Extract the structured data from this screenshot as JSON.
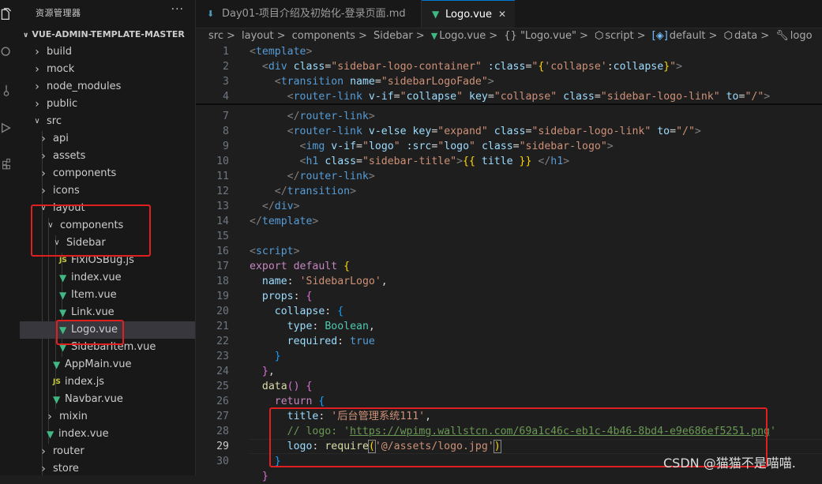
{
  "activity_bar": {
    "icons": [
      "files-icon",
      "search-icon",
      "source-control-icon",
      "run-debug-icon",
      "extensions-icon"
    ]
  },
  "explorer": {
    "title": "资源管理器",
    "more": "···",
    "project": "VUE-ADMIN-TEMPLATE-MASTER",
    "items": [
      {
        "label": "build",
        "type": "folder",
        "open": false
      },
      {
        "label": "mock",
        "type": "folder",
        "open": false
      },
      {
        "label": "node_modules",
        "type": "folder",
        "open": false
      },
      {
        "label": "public",
        "type": "folder",
        "open": false
      },
      {
        "label": "src",
        "type": "folder",
        "open": true
      },
      {
        "label": "api",
        "type": "folder",
        "open": false
      },
      {
        "label": "assets",
        "type": "folder",
        "open": false
      },
      {
        "label": "components",
        "type": "folder",
        "open": false
      },
      {
        "label": "icons",
        "type": "folder",
        "open": false
      },
      {
        "label": "layout",
        "type": "folder",
        "open": true
      },
      {
        "label": "components",
        "type": "folder",
        "open": true
      },
      {
        "label": "Sidebar",
        "type": "folder",
        "open": true
      },
      {
        "label": "FixiOSBug.js",
        "type": "js"
      },
      {
        "label": "index.vue",
        "type": "vue"
      },
      {
        "label": "Item.vue",
        "type": "vue"
      },
      {
        "label": "Link.vue",
        "type": "vue"
      },
      {
        "label": "Logo.vue",
        "type": "vue",
        "selected": true
      },
      {
        "label": "SidebarItem.vue",
        "type": "vue"
      },
      {
        "label": "AppMain.vue",
        "type": "vue"
      },
      {
        "label": "index.js",
        "type": "js"
      },
      {
        "label": "Navbar.vue",
        "type": "vue"
      },
      {
        "label": "mixin",
        "type": "folder",
        "open": false
      },
      {
        "label": "index.vue",
        "type": "vue"
      },
      {
        "label": "router",
        "type": "folder",
        "open": false
      },
      {
        "label": "store",
        "type": "folder",
        "open": false
      }
    ],
    "js_badge": "JS",
    "vue_badge": "▼"
  },
  "tabs": [
    {
      "label": "Day01-项目介绍及初始化-登录页面.md",
      "icon": "markdown-icon",
      "active": false
    },
    {
      "label": "Logo.vue",
      "icon": "vue-icon",
      "active": true,
      "close": "✕"
    }
  ],
  "breadcrumb": {
    "items": [
      "src",
      "layout",
      "components",
      "Sidebar",
      "Logo.vue",
      "{} \"Logo.vue\"",
      "script",
      "default",
      "data",
      "logo"
    ],
    "separator": ">"
  },
  "editor": {
    "current_line": 29,
    "lines": [
      {
        "n": "1"
      },
      {
        "n": "2"
      },
      {
        "n": "3"
      },
      {
        "n": "4"
      },
      {
        "n": "7"
      },
      {
        "n": "8"
      },
      {
        "n": "9"
      },
      {
        "n": "10"
      },
      {
        "n": "11"
      },
      {
        "n": "12"
      },
      {
        "n": "13"
      },
      {
        "n": "14"
      },
      {
        "n": "15"
      },
      {
        "n": "16"
      },
      {
        "n": "17"
      },
      {
        "n": "18"
      },
      {
        "n": "19"
      },
      {
        "n": "20"
      },
      {
        "n": "21"
      },
      {
        "n": "22"
      },
      {
        "n": "23"
      },
      {
        "n": "24"
      },
      {
        "n": "25"
      },
      {
        "n": "26"
      },
      {
        "n": "27"
      },
      {
        "n": "28"
      },
      {
        "n": "29"
      },
      {
        "n": "30"
      }
    ]
  },
  "watermark": "CSDN @猫猫不是喵喵."
}
